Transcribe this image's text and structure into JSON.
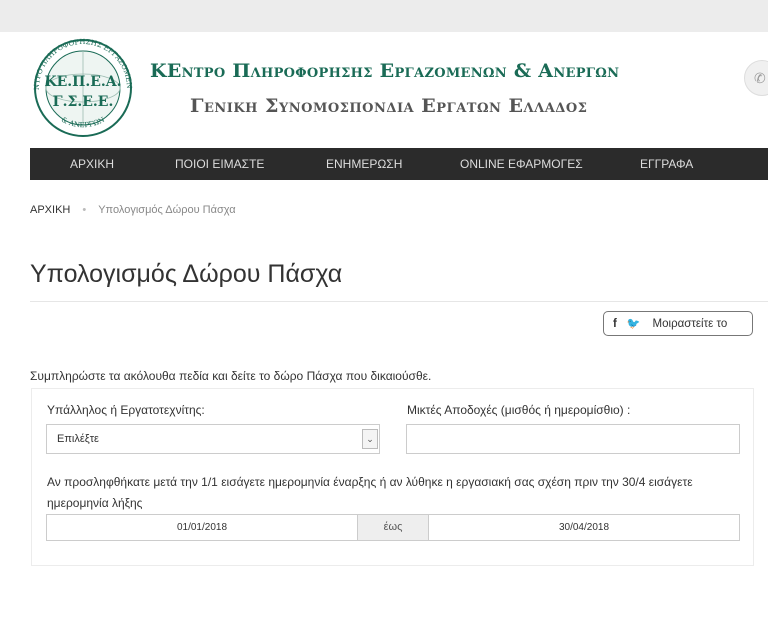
{
  "header": {
    "logo_top_text": "ΚΕΝΤΡΟ ΠΛΗΡΟΦΟΡΗΣΗΣ ΕΡΓΑΖΟΜΕΝΩΝ",
    "logo_bottom_text": "& ΑΝΕΡΓΩΝ",
    "logo_line1": "ΚΕ.Π.Ε.Α.",
    "logo_line2": "Γ.Σ.Ε.Ε.",
    "title_line1": "ΚΕντρο Πληροφορησησ Εργαζομενων & Ανεργων",
    "title_line2": "Γενικη Συνομοσπονδια Εργατων Ελλαδοσ"
  },
  "nav": {
    "items": [
      "ΑΡΧΙΚΗ",
      "ΠΟΙΟΙ ΕΙΜΑΣΤΕ",
      "ΕΝΗΜΕΡΩΣΗ",
      "ONLINE ΕΦΑΡΜΟΓΕΣ",
      "ΕΓΓΡΑΦΑ"
    ]
  },
  "breadcrumb": {
    "home": "ΑΡΧΙΚΗ",
    "current": "Υπολογισμός Δώρου Πάσχα"
  },
  "page_title": "Υπολογισμός Δώρου Πάσχα",
  "share": {
    "label": "Μοιραστείτε το"
  },
  "form": {
    "intro": "Συμπληρώστε τα ακόλουθα πεδία και δείτε το δώρο Πάσχα που δικαιούσθε.",
    "employee_type_label": "Υπάλληλος ή Εργατοτεχνίτης:",
    "employee_type_value": "Επιλέξτε",
    "wage_label": "Μικτές Αποδοχές (μισθός ή ημερομίσθιο) :",
    "wage_value": "",
    "note": "Αν προσληφθήκατε μετά την 1/1 εισάγετε ημερομηνία έναρξης ή αν λύθηκε η εργασιακή σας σχέση πριν την 30/4 εισάγετε ημερομηνία λήξης",
    "start_date": "01/01/2018",
    "until_label": "έως",
    "end_date": "30/04/2018"
  }
}
